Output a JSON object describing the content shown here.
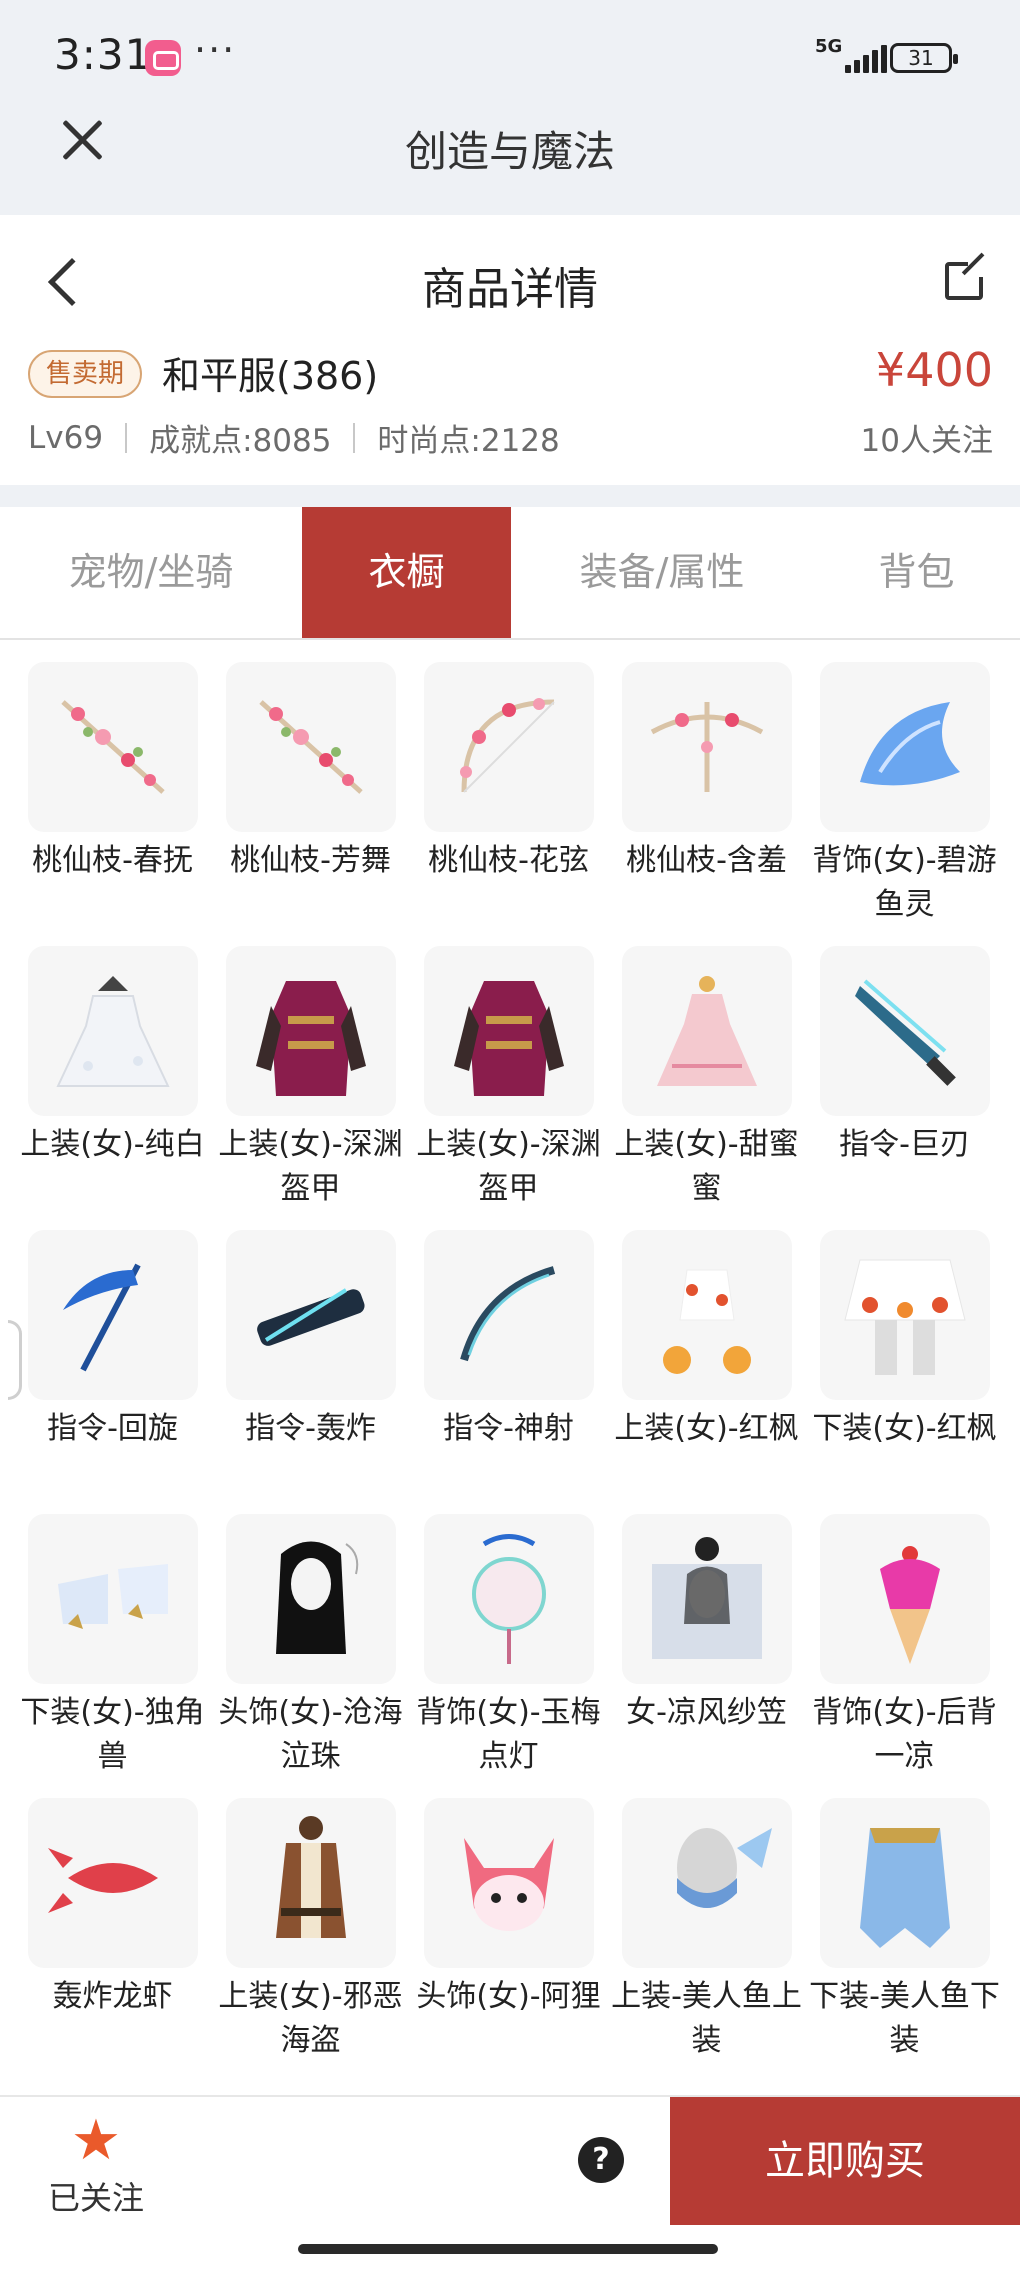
{
  "status_bar": {
    "time": "3:31",
    "dots": "···",
    "network": "5G",
    "battery": "31"
  },
  "app": {
    "title": "创造与魔法"
  },
  "header": {
    "title": "商品详情"
  },
  "product": {
    "badge": "售卖期",
    "name": "和平服(386)",
    "price": "¥400",
    "level": "Lv69",
    "achievement": "成就点:8085",
    "fashion": "时尚点:2128",
    "followers": "10人关注"
  },
  "tabs": [
    {
      "label": "宠物/坐骑",
      "active": false
    },
    {
      "label": "衣橱",
      "active": true
    },
    {
      "label": "装备/属性",
      "active": false
    },
    {
      "label": "背包",
      "active": false
    }
  ],
  "items": [
    {
      "label": "桃仙枝-春抚",
      "icon": "peach-branch"
    },
    {
      "label": "桃仙枝-芳舞",
      "icon": "peach-branch"
    },
    {
      "label": "桃仙枝-花弦",
      "icon": "peach-bow"
    },
    {
      "label": "桃仙枝-含羞",
      "icon": "peach-crossbow"
    },
    {
      "label": "背饰(女)-碧游鱼灵",
      "icon": "blue-fish-wing"
    },
    {
      "label": "上装(女)-纯白",
      "icon": "white-dress"
    },
    {
      "label": "上装(女)-深渊盔甲",
      "icon": "abyss-armor"
    },
    {
      "label": "上装(女)-深渊盔甲",
      "icon": "abyss-armor"
    },
    {
      "label": "上装(女)-甜蜜蜜",
      "icon": "pink-dress"
    },
    {
      "label": "指令-巨刃",
      "icon": "giant-blade"
    },
    {
      "label": "指令-回旋",
      "icon": "scythe"
    },
    {
      "label": "指令-轰炸",
      "icon": "cannon"
    },
    {
      "label": "指令-神射",
      "icon": "bow-blue"
    },
    {
      "label": "上装(女)-红枫",
      "icon": "maple-top"
    },
    {
      "label": "下装(女)-红枫",
      "icon": "maple-skirt"
    },
    {
      "label": "下装(女)-独角兽",
      "icon": "unicorn-boots"
    },
    {
      "label": "头饰(女)-沧海泣珠",
      "icon": "hair-head"
    },
    {
      "label": "背饰(女)-玉梅点灯",
      "icon": "lantern"
    },
    {
      "label": "女-凉风纱笠",
      "icon": "veil-hat"
    },
    {
      "label": "背饰(女)-后背一凉",
      "icon": "ice-cream"
    },
    {
      "label": "轰炸龙虾",
      "icon": "lobster"
    },
    {
      "label": "上装(女)-邪恶海盗",
      "icon": "pirate-coat"
    },
    {
      "label": "头饰(女)-阿狸",
      "icon": "fox-head"
    },
    {
      "label": "上装-美人鱼上装",
      "icon": "mermaid-top"
    },
    {
      "label": "下装-美人鱼下装",
      "icon": "mermaid-bottom"
    }
  ],
  "bottom": {
    "follow_label": "已关注",
    "help": "?",
    "buy_label": "立即购买"
  },
  "colors": {
    "accent": "#b63b34",
    "price": "#c9453a",
    "badge": "#c36a32",
    "star": "#ea5a2b"
  }
}
